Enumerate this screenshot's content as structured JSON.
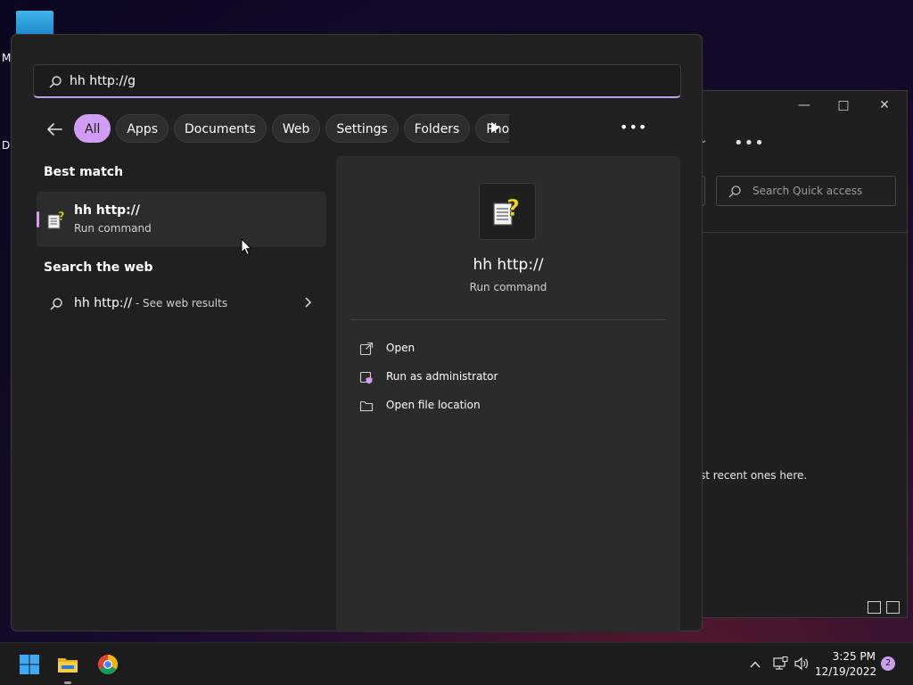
{
  "desktop": {
    "label_m": "M",
    "label_d": "D"
  },
  "explorer": {
    "more_label": "•••",
    "search_placeholder": "Search Quick access",
    "recent_text": "st recent ones here."
  },
  "search": {
    "query": "hh http://g",
    "filters": [
      {
        "label": "All",
        "active": true
      },
      {
        "label": "Apps"
      },
      {
        "label": "Documents"
      },
      {
        "label": "Web"
      },
      {
        "label": "Settings"
      },
      {
        "label": "Folders"
      },
      {
        "label": "Photos"
      }
    ],
    "more_label": "•••",
    "best_match_title": "Best match",
    "best_match": {
      "title": "hh http://",
      "subtitle": "Run command",
      "icon": "help-file-icon"
    },
    "web_title": "Search the web",
    "web_result": {
      "query": "hh http://",
      "suffix": " - See web results"
    }
  },
  "details": {
    "title": "hh http://",
    "subtitle": "Run command",
    "actions": [
      {
        "label": "Open",
        "icon": "open-external-icon"
      },
      {
        "label": "Run as administrator",
        "icon": "admin-shield-icon"
      },
      {
        "label": "Open file location",
        "icon": "folder-icon"
      }
    ]
  },
  "taskbar": {
    "time": "3:25 PM",
    "date": "12/19/2022",
    "notification_count": "2"
  },
  "colors": {
    "accent": "#d19cf3",
    "panel_bg": "#202020",
    "detail_bg": "#2b2b2b"
  }
}
